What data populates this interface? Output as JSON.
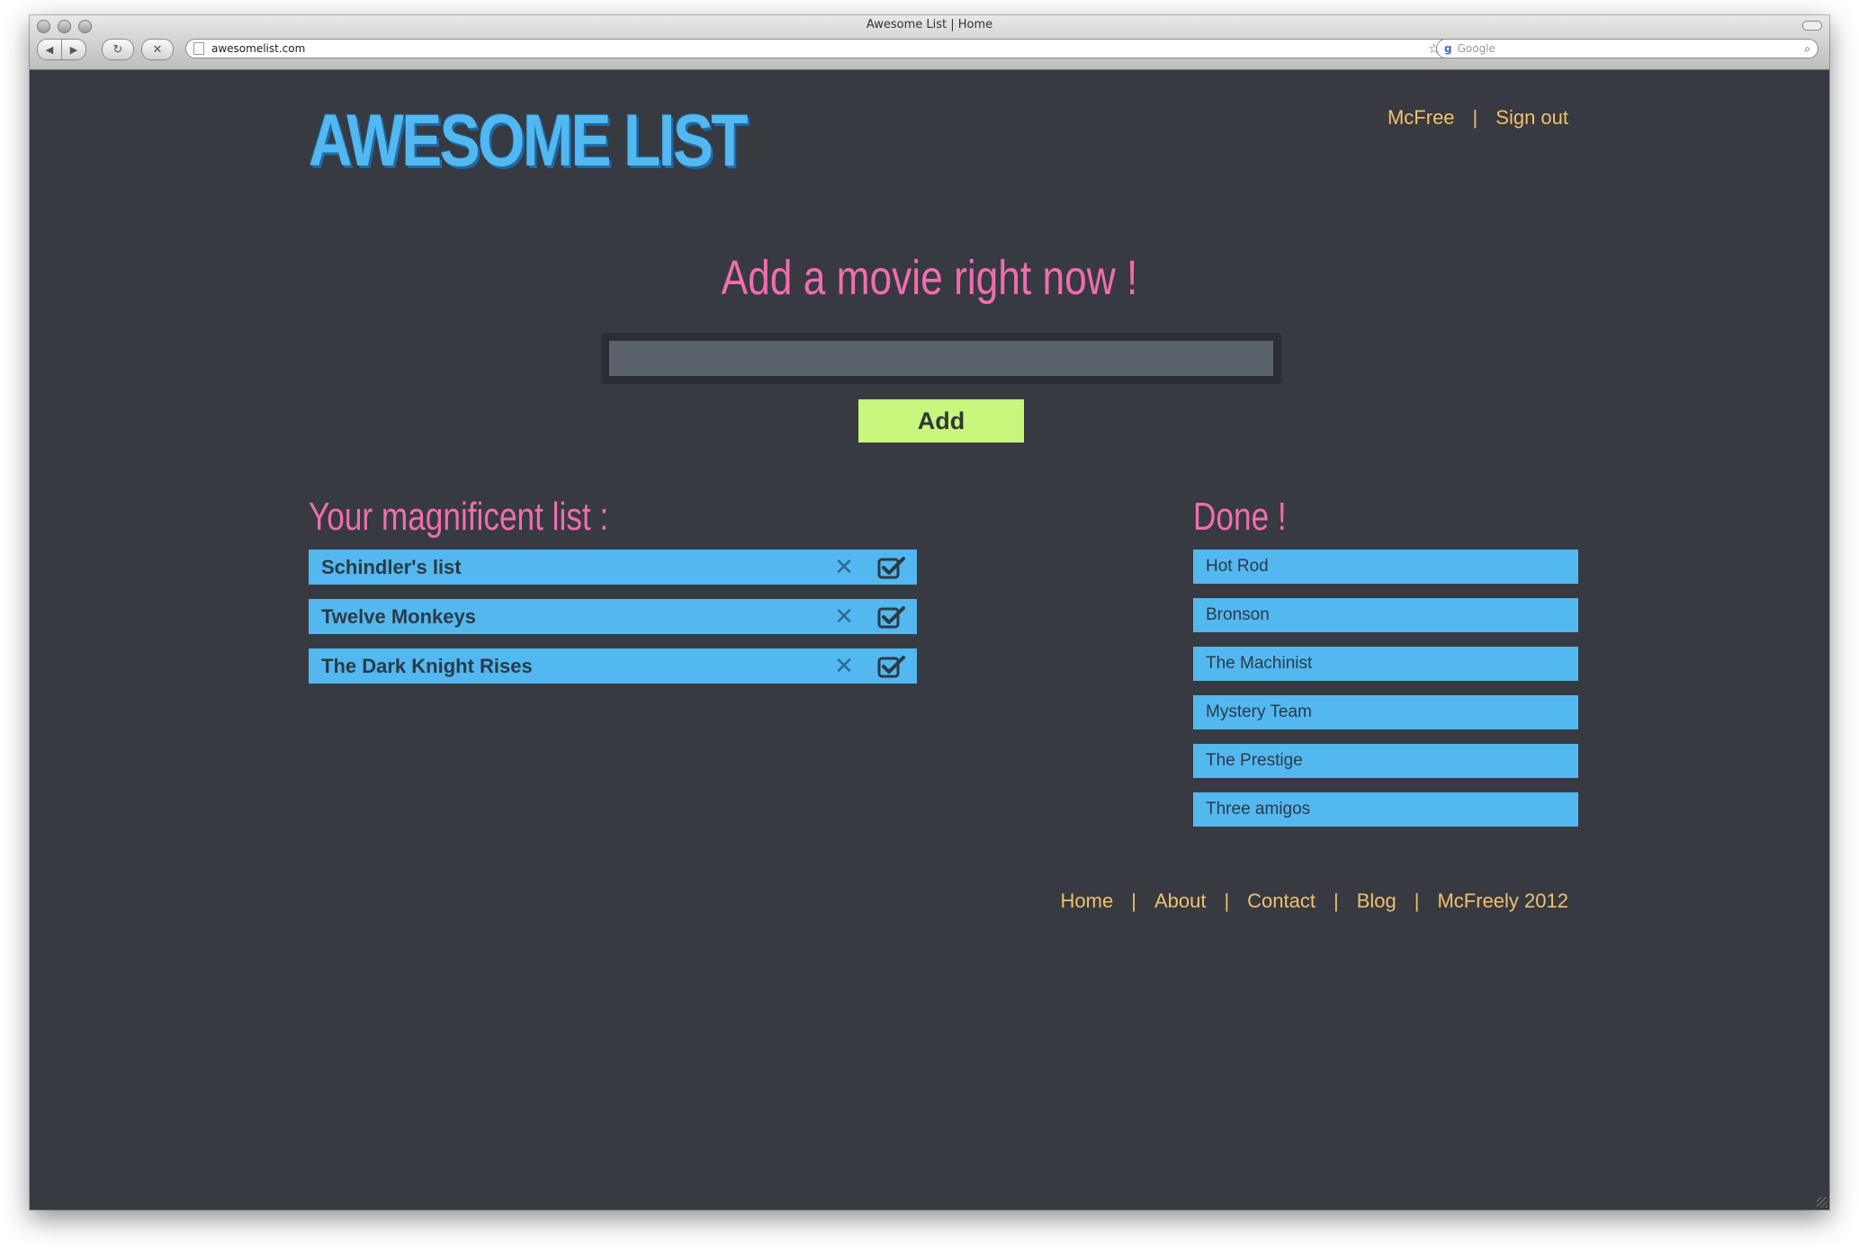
{
  "browser": {
    "window_title": "Awesome List | Home",
    "url": "awesomelist.com",
    "search_placeholder": "Google"
  },
  "header": {
    "logo_text": "AWESOME LIST",
    "user_name": "McFree",
    "separator": "|",
    "sign_out_label": "Sign out"
  },
  "add_section": {
    "title": "Add a movie right now !",
    "input_value": "",
    "button_label": "Add"
  },
  "todo_list": {
    "title": "Your magnificent list :",
    "items": [
      {
        "label": "Schindler's list"
      },
      {
        "label": "Twelve Monkeys"
      },
      {
        "label": "The Dark Knight Rises"
      }
    ]
  },
  "done_list": {
    "title": "Done !",
    "items": [
      {
        "label": "Hot Rod"
      },
      {
        "label": "Bronson"
      },
      {
        "label": "The Machinist"
      },
      {
        "label": "Mystery Team"
      },
      {
        "label": "The Prestige"
      },
      {
        "label": "Three amigos"
      }
    ]
  },
  "footer": {
    "links": [
      "Home",
      "About",
      "Contact",
      "Blog",
      "McFreely 2012"
    ],
    "separator": "|"
  },
  "icons": {
    "remove": "close-icon",
    "mark_done": "checkbox-checked-icon"
  },
  "colors": {
    "background": "#373a40",
    "accent_pink": "#f06daf",
    "accent_blue": "#53b8f0",
    "link_gold": "#f1c06b",
    "button_green": "#c7f77c"
  }
}
